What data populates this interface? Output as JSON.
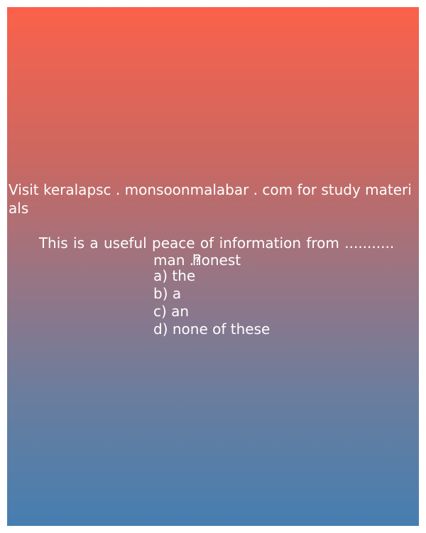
{
  "promo_text": "Visit keralapsc . monsoonmalabar . com for study materials",
  "question": {
    "line1": "This is a useful peace of information from ........... honest",
    "line2": "man .?"
  },
  "options": [
    "a) the",
    "b) a",
    "c) an",
    "d) none of these"
  ],
  "colors": {
    "gradient_top": "#fb614a",
    "gradient_bottom": "#467eb0",
    "text": "#ffffff"
  }
}
